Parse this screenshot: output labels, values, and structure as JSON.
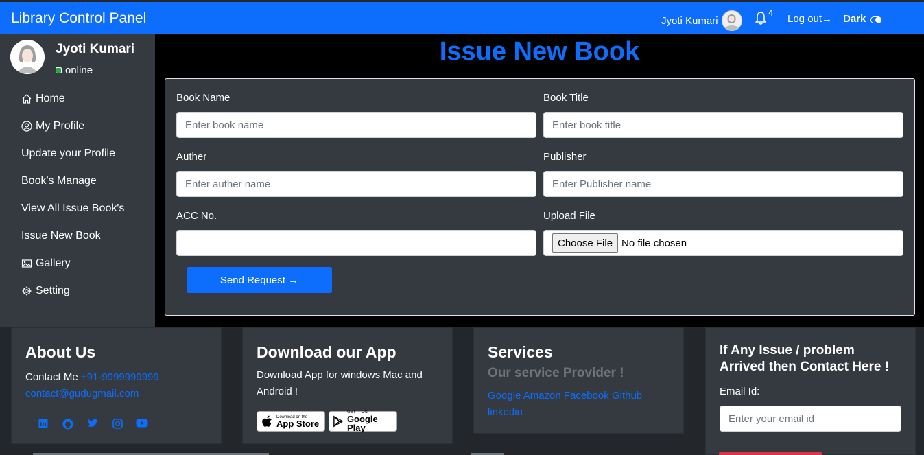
{
  "header": {
    "brand": "Library Control Panel",
    "user_name": "Jyoti Kumari",
    "notification_count": "4",
    "logout_label": "Log out→",
    "theme_label": "Dark",
    "accent_color": "#0d6efd"
  },
  "sidebar": {
    "user_name": "Jyoti Kumari",
    "status": "online",
    "items": [
      {
        "label": "Home",
        "icon": "home-icon"
      },
      {
        "label": "My Profile",
        "icon": "user-circle-icon"
      },
      {
        "label": "Update your Profile",
        "icon": ""
      },
      {
        "label": "Book's Manage",
        "icon": ""
      },
      {
        "label": "View All Issue Book's",
        "icon": ""
      },
      {
        "label": "Issue New Book",
        "icon": ""
      },
      {
        "label": "Gallery",
        "icon": "image-icon"
      },
      {
        "label": "Setting",
        "icon": "gear-icon"
      }
    ]
  },
  "main": {
    "title": "Issue New Book",
    "form": {
      "book_name_label": "Book Name",
      "book_name_placeholder": "Enter book name",
      "book_title_label": "Book Title",
      "book_title_placeholder": "Enter book title",
      "author_label": "Auther",
      "author_placeholder": "Enter auther name",
      "publisher_label": "Publisher",
      "publisher_placeholder": "Enter Publisher name",
      "acc_label": "ACC No.",
      "acc_value": "",
      "upload_label": "Upload File",
      "choose_file_label": "Choose File",
      "no_file_text": "No file chosen",
      "send_label": "Send Request →"
    }
  },
  "footer": {
    "about": {
      "heading": "About Us",
      "contact_prefix": "Contact Me",
      "phone": "+91-9999999999",
      "email": "contact@gudugmail.com",
      "social_icons": [
        "linkedin-icon",
        "github-icon",
        "twitter-icon",
        "instagram-icon",
        "youtube-icon"
      ]
    },
    "app": {
      "heading": "Download our App",
      "text_line1": "Download App for windows Mac and",
      "text_line2": "Android !",
      "appstore_small": "Download on the",
      "appstore_big": "App Store",
      "googleplay_small": "GET IT ON",
      "googleplay_big": "Google Play"
    },
    "services": {
      "heading": "Services",
      "subheading": "Our service Provider !",
      "links_line1": "Google Amazon Facebook Github",
      "links_line2": "linkedin"
    },
    "contact": {
      "heading_line1": "If Any Issue / problem",
      "heading_line2": "Arrived then Contact Here !",
      "email_label": "Email Id:",
      "email_placeholder": "Enter your email id"
    }
  }
}
